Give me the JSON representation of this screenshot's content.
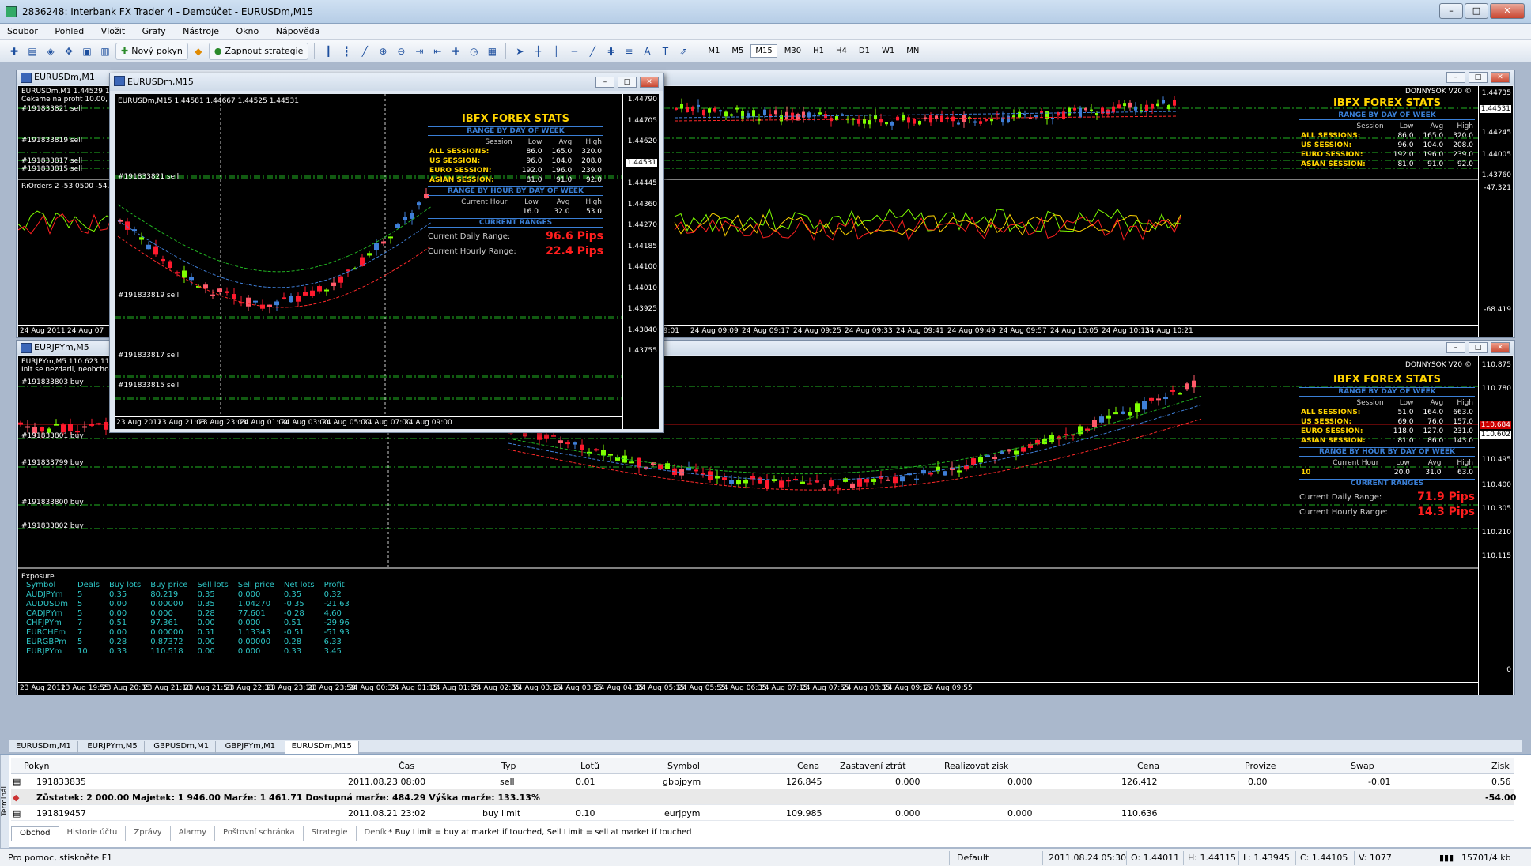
{
  "app": {
    "title": "2836248: Interbank FX Trader 4 - Demoúčet - EURUSDm,M15"
  },
  "menu": [
    "Soubor",
    "Pohled",
    "Vložit",
    "Grafy",
    "Nástroje",
    "Okno",
    "Nápověda"
  ],
  "toolbar": {
    "new_order": "Nový pokyn",
    "autotrading": "Zapnout strategie",
    "timeframes": [
      "M1",
      "M5",
      "M15",
      "M30",
      "H1",
      "H4",
      "D1",
      "W1",
      "MN"
    ],
    "active_tf": "M15"
  },
  "charts": {
    "eurusd_m1": {
      "title": "EURUSDm,M1",
      "header": "EURUSDm,M1 1.44529 1",
      "status": "Cekame na profit 10.00, z",
      "copyright": "DONNYSOK V20 ©",
      "indicator": "RiOrders 2 -53.0500 -54.1",
      "orders": [
        "#191833821 sell",
        "#191833819 sell",
        "#191833817 sell",
        "#191833815 sell"
      ],
      "y": [
        "1.44735",
        "1.44531",
        "1.44245",
        "1.44005",
        "1.43760",
        "-47.321",
        "-68.419"
      ],
      "x": [
        "24 Aug 2011",
        "24 Aug 07",
        "09:01",
        "24 Aug 09:09",
        "24 Aug 09:17",
        "24 Aug 09:25",
        "24 Aug 09:33",
        "24 Aug 09:41",
        "24 Aug 09:49",
        "24 Aug 09:57",
        "24 Aug 10:05",
        "24 Aug 10:13",
        "24 Aug 10:21"
      ]
    },
    "eurjpy_m5": {
      "title": "EURJPYm,M5",
      "header": "EURJPYm,M5 110.623 11",
      "status": "Init se nezdaril, neobchodu",
      "copyright": "DONNYSOK V20 ©",
      "orders": [
        "#191833803 buy",
        "#191833801 buy",
        "#191833799 buy",
        "#191833800 buy",
        "#191833802 buy"
      ],
      "y": [
        "110.875",
        "110.780",
        "110.684",
        "110.602",
        "110.495",
        "110.400",
        "110.305",
        "110.210",
        "110.115",
        "0"
      ],
      "x": [
        "23 Aug 2011",
        "23 Aug 19:55",
        "23 Aug 20:35",
        "23 Aug 21:18",
        "23 Aug 21:58",
        "23 Aug 22:38",
        "23 Aug 23:18",
        "23 Aug 23:58",
        "24 Aug 00:35",
        "24 Aug 01:15",
        "24 Aug 01:55",
        "24 Aug 02:35",
        "24 Aug 03:15",
        "24 Aug 03:55",
        "24 Aug 04:35",
        "24 Aug 05:15",
        "24 Aug 05:55",
        "24 Aug 06:35",
        "24 Aug 07:15",
        "24 Aug 07:55",
        "24 Aug 08:35",
        "24 Aug 09:15",
        "24 Aug 09:55"
      ]
    },
    "eurusd_m15": {
      "title": "EURUSDm,M15",
      "header": "EURUSDm,M15 1.44581 1.44667 1.44525 1.44531",
      "orders": [
        "#191833821 sell",
        "#191833819 sell",
        "#191833817 sell",
        "#191833815 sell"
      ],
      "y": [
        "1.44790",
        "1.44705",
        "1.44620",
        "1.44531",
        "1.44445",
        "1.44360",
        "1.44270",
        "1.44185",
        "1.44100",
        "1.44010",
        "1.43925",
        "1.43840",
        "1.43755"
      ],
      "x": [
        "23 Aug 2011",
        "23 Aug 21:03",
        "23 Aug 23:03",
        "24 Aug 01:00",
        "24 Aug 03:00",
        "24 Aug 05:00",
        "24 Aug 07:00",
        "24 Aug 09:00"
      ]
    }
  },
  "stats_eurusd": {
    "title": "IBFX FOREX STATS",
    "sec1": "RANGE BY DAY OF WEEK",
    "head": [
      "Session",
      "Low",
      "Avg",
      "High"
    ],
    "rows": [
      {
        "l": "ALL SESSIONS:",
        "v": [
          "86.0",
          "165.0",
          "320.0"
        ]
      },
      {
        "l": "US SESSION:",
        "v": [
          "96.0",
          "104.0",
          "208.0"
        ]
      },
      {
        "l": "EURO SESSION:",
        "v": [
          "192.0",
          "196.0",
          "239.0"
        ]
      },
      {
        "l": "ASIAN SESSION:",
        "v": [
          "81.0",
          "91.0",
          "92.0"
        ]
      }
    ],
    "sec2": "RANGE BY HOUR BY DAY OF WEEK",
    "head2": [
      "Current Hour",
      "Low",
      "Avg",
      "High"
    ],
    "hour": [
      "",
      "16.0",
      "32.0",
      "53.0"
    ],
    "sec3": "CURRENT RANGES",
    "daily_label": "Current Daily Range:",
    "daily": "96.6 Pips",
    "hourly_label": "Current Hourly Range:",
    "hourly": "22.4 Pips"
  },
  "stats_eurjpy": {
    "title": "IBFX FOREX STATS",
    "sec1": "RANGE BY DAY OF WEEK",
    "head": [
      "Session",
      "Low",
      "Avg",
      "High"
    ],
    "rows": [
      {
        "l": "ALL SESSIONS:",
        "v": [
          "51.0",
          "164.0",
          "663.0"
        ]
      },
      {
        "l": "US SESSION:",
        "v": [
          "69.0",
          "76.0",
          "157.0"
        ]
      },
      {
        "l": "EURO SESSION:",
        "v": [
          "118.0",
          "127.0",
          "231.0"
        ]
      },
      {
        "l": "ASIAN SESSION:",
        "v": [
          "81.0",
          "86.0",
          "143.0"
        ]
      }
    ],
    "sec2": "RANGE BY HOUR BY DAY OF WEEK",
    "head2": [
      "Current Hour",
      "Low",
      "Avg",
      "High"
    ],
    "hour": [
      "10",
      "20.0",
      "31.0",
      "63.0"
    ],
    "sec3": "CURRENT RANGES",
    "daily_label": "Current Daily Range:",
    "daily": "71.9 Pips",
    "hourly_label": "Current Hourly Range:",
    "hourly": "14.3 Pips"
  },
  "exposure": {
    "title": "Exposure",
    "head": [
      "Symbol",
      "Deals",
      "Buy lots",
      "Buy price",
      "Sell lots",
      "Sell price",
      "Net lots",
      "Profit"
    ],
    "rows": [
      [
        "AUDJPYm",
        "5",
        "0.35",
        "80.219",
        "0.35",
        "0.000",
        "0.35",
        "0.32"
      ],
      [
        "AUDUSDm",
        "5",
        "0.00",
        "0.00000",
        "0.35",
        "1.04270",
        "-0.35",
        "-21.63"
      ],
      [
        "CADJPYm",
        "5",
        "0.00",
        "0.000",
        "0.28",
        "77.601",
        "-0.28",
        "4.60"
      ],
      [
        "CHFJPYm",
        "7",
        "0.51",
        "97.361",
        "0.00",
        "0.000",
        "0.51",
        "-29.96"
      ],
      [
        "EURCHFm",
        "7",
        "0.00",
        "0.00000",
        "0.51",
        "1.13343",
        "-0.51",
        "-51.93"
      ],
      [
        "EURGBPm",
        "5",
        "0.28",
        "0.87372",
        "0.00",
        "0.00000",
        "0.28",
        "6.33"
      ],
      [
        "EURJPYm",
        "10",
        "0.33",
        "110.518",
        "0.00",
        "0.000",
        "0.33",
        "3.45"
      ]
    ]
  },
  "chart_tabs": [
    "EURUSDm,M1",
    "EURJPYm,M5",
    "GBPUSDm,M1",
    "GBPJPYm,M1",
    "EURUSDm,M15"
  ],
  "terminal": {
    "side": "Terminál",
    "head": [
      "Pokyn",
      "Čas",
      "Typ",
      "Lotů",
      "Symbol",
      "Cena",
      "Zastavení ztrát",
      "Realizovat zisk",
      "Cena",
      "Provize",
      "Swap",
      "Zisk"
    ],
    "rows": [
      [
        "191833835",
        "2011.08.23 08:00",
        "sell",
        "0.01",
        "gbpjpym",
        "126.845",
        "0.000",
        "0.000",
        "126.412",
        "0.00",
        "-0.01",
        "0.56"
      ]
    ],
    "balance": "Zůstatek: 2 000.00  Majetek: 1 946.00  Marže: 1 461.71  Dostupná marže: 484.29  Výška marže: 133.13%",
    "balance_profit": "-54.00",
    "row2": [
      "191819457",
      "2011.08.21 23:02",
      "buy limit",
      "0.10",
      "eurjpym",
      "109.985",
      "0.000",
      "0.000",
      "110.636"
    ],
    "tabs": [
      "Obchod",
      "Historie účtu",
      "Zprávy",
      "Alarmy",
      "Poštovní schránka",
      "Strategie",
      "Deník"
    ],
    "note": "* Buy Limit = buy at market if touched, Sell Limit = sell at market if touched"
  },
  "status": {
    "help": "Pro pomoc, stiskněte F1",
    "profile": "Default",
    "time": "2011.08.24 05:30",
    "o": "O: 1.44011",
    "h": "H: 1.44115",
    "l": "L: 1.43945",
    "c": "C: 1.44105",
    "v": "V: 1077",
    "traffic": "15701/4 kb"
  }
}
